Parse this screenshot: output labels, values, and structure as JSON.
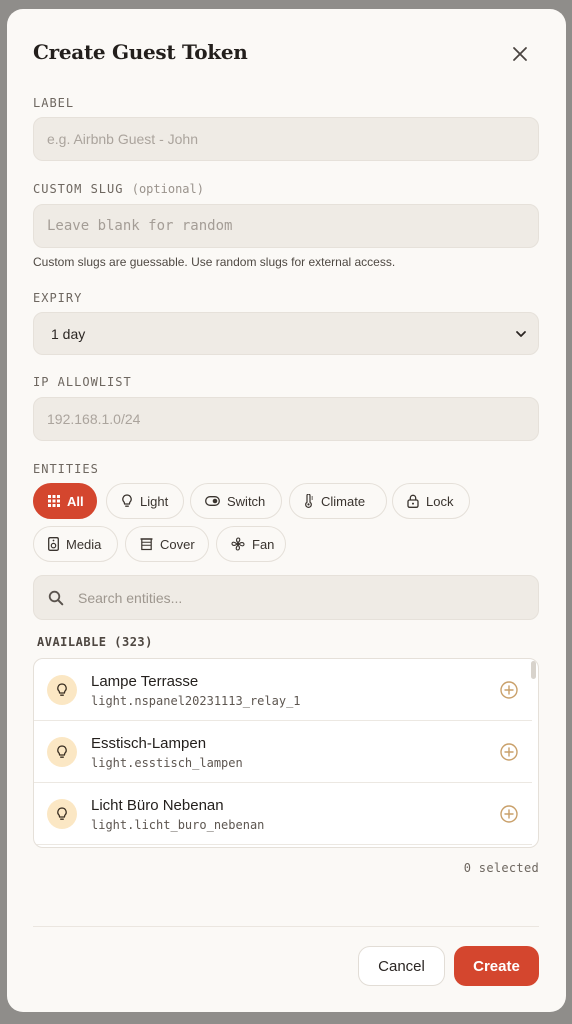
{
  "modal": {
    "title": "Create Guest Token",
    "close_icon": "close-icon"
  },
  "label_field": {
    "label": "LABEL",
    "placeholder": "e.g. Airbnb Guest - John",
    "value": ""
  },
  "slug_field": {
    "label": "CUSTOM SLUG",
    "optional": "(optional)",
    "placeholder": "Leave blank for random",
    "value": "",
    "hint": "Custom slugs are guessable. Use random slugs for external access."
  },
  "expiry": {
    "label": "EXPIRY",
    "selected": "1 day"
  },
  "ip_allowlist": {
    "label": "IP ALLOWLIST",
    "placeholder": "192.168.1.0/24",
    "value": ""
  },
  "entities": {
    "label": "ENTITIES",
    "filters": [
      {
        "label": "All",
        "icon": "grid-icon",
        "active": true
      },
      {
        "label": "Light",
        "icon": "lightbulb-icon",
        "active": false
      },
      {
        "label": "Switch",
        "icon": "toggle-icon",
        "active": false
      },
      {
        "label": "Climate",
        "icon": "thermometer-icon",
        "active": false
      },
      {
        "label": "Lock",
        "icon": "lock-icon",
        "active": false
      },
      {
        "label": "Media",
        "icon": "speaker-icon",
        "active": false
      },
      {
        "label": "Cover",
        "icon": "blinds-icon",
        "active": false
      },
      {
        "label": "Fan",
        "icon": "fan-icon",
        "active": false
      }
    ],
    "search_placeholder": "Search entities...",
    "available_label": "AVAILABLE (323)",
    "items": [
      {
        "name": "Lampe Terrasse",
        "entity_id": "light.nspanel20231113_relay_1"
      },
      {
        "name": "Esstisch-Lampen",
        "entity_id": "light.esstisch_lampen"
      },
      {
        "name": "Licht Büro Nebenan",
        "entity_id": "light.licht_buro_nebenan"
      }
    ],
    "selected_count": "0 selected"
  },
  "actions": {
    "cancel_label": "Cancel",
    "create_label": "Create"
  },
  "colors": {
    "accent": "#d4462e",
    "surface": "#fbf9f6",
    "field": "#efebe5",
    "icon_bg": "#fbe7c4"
  }
}
